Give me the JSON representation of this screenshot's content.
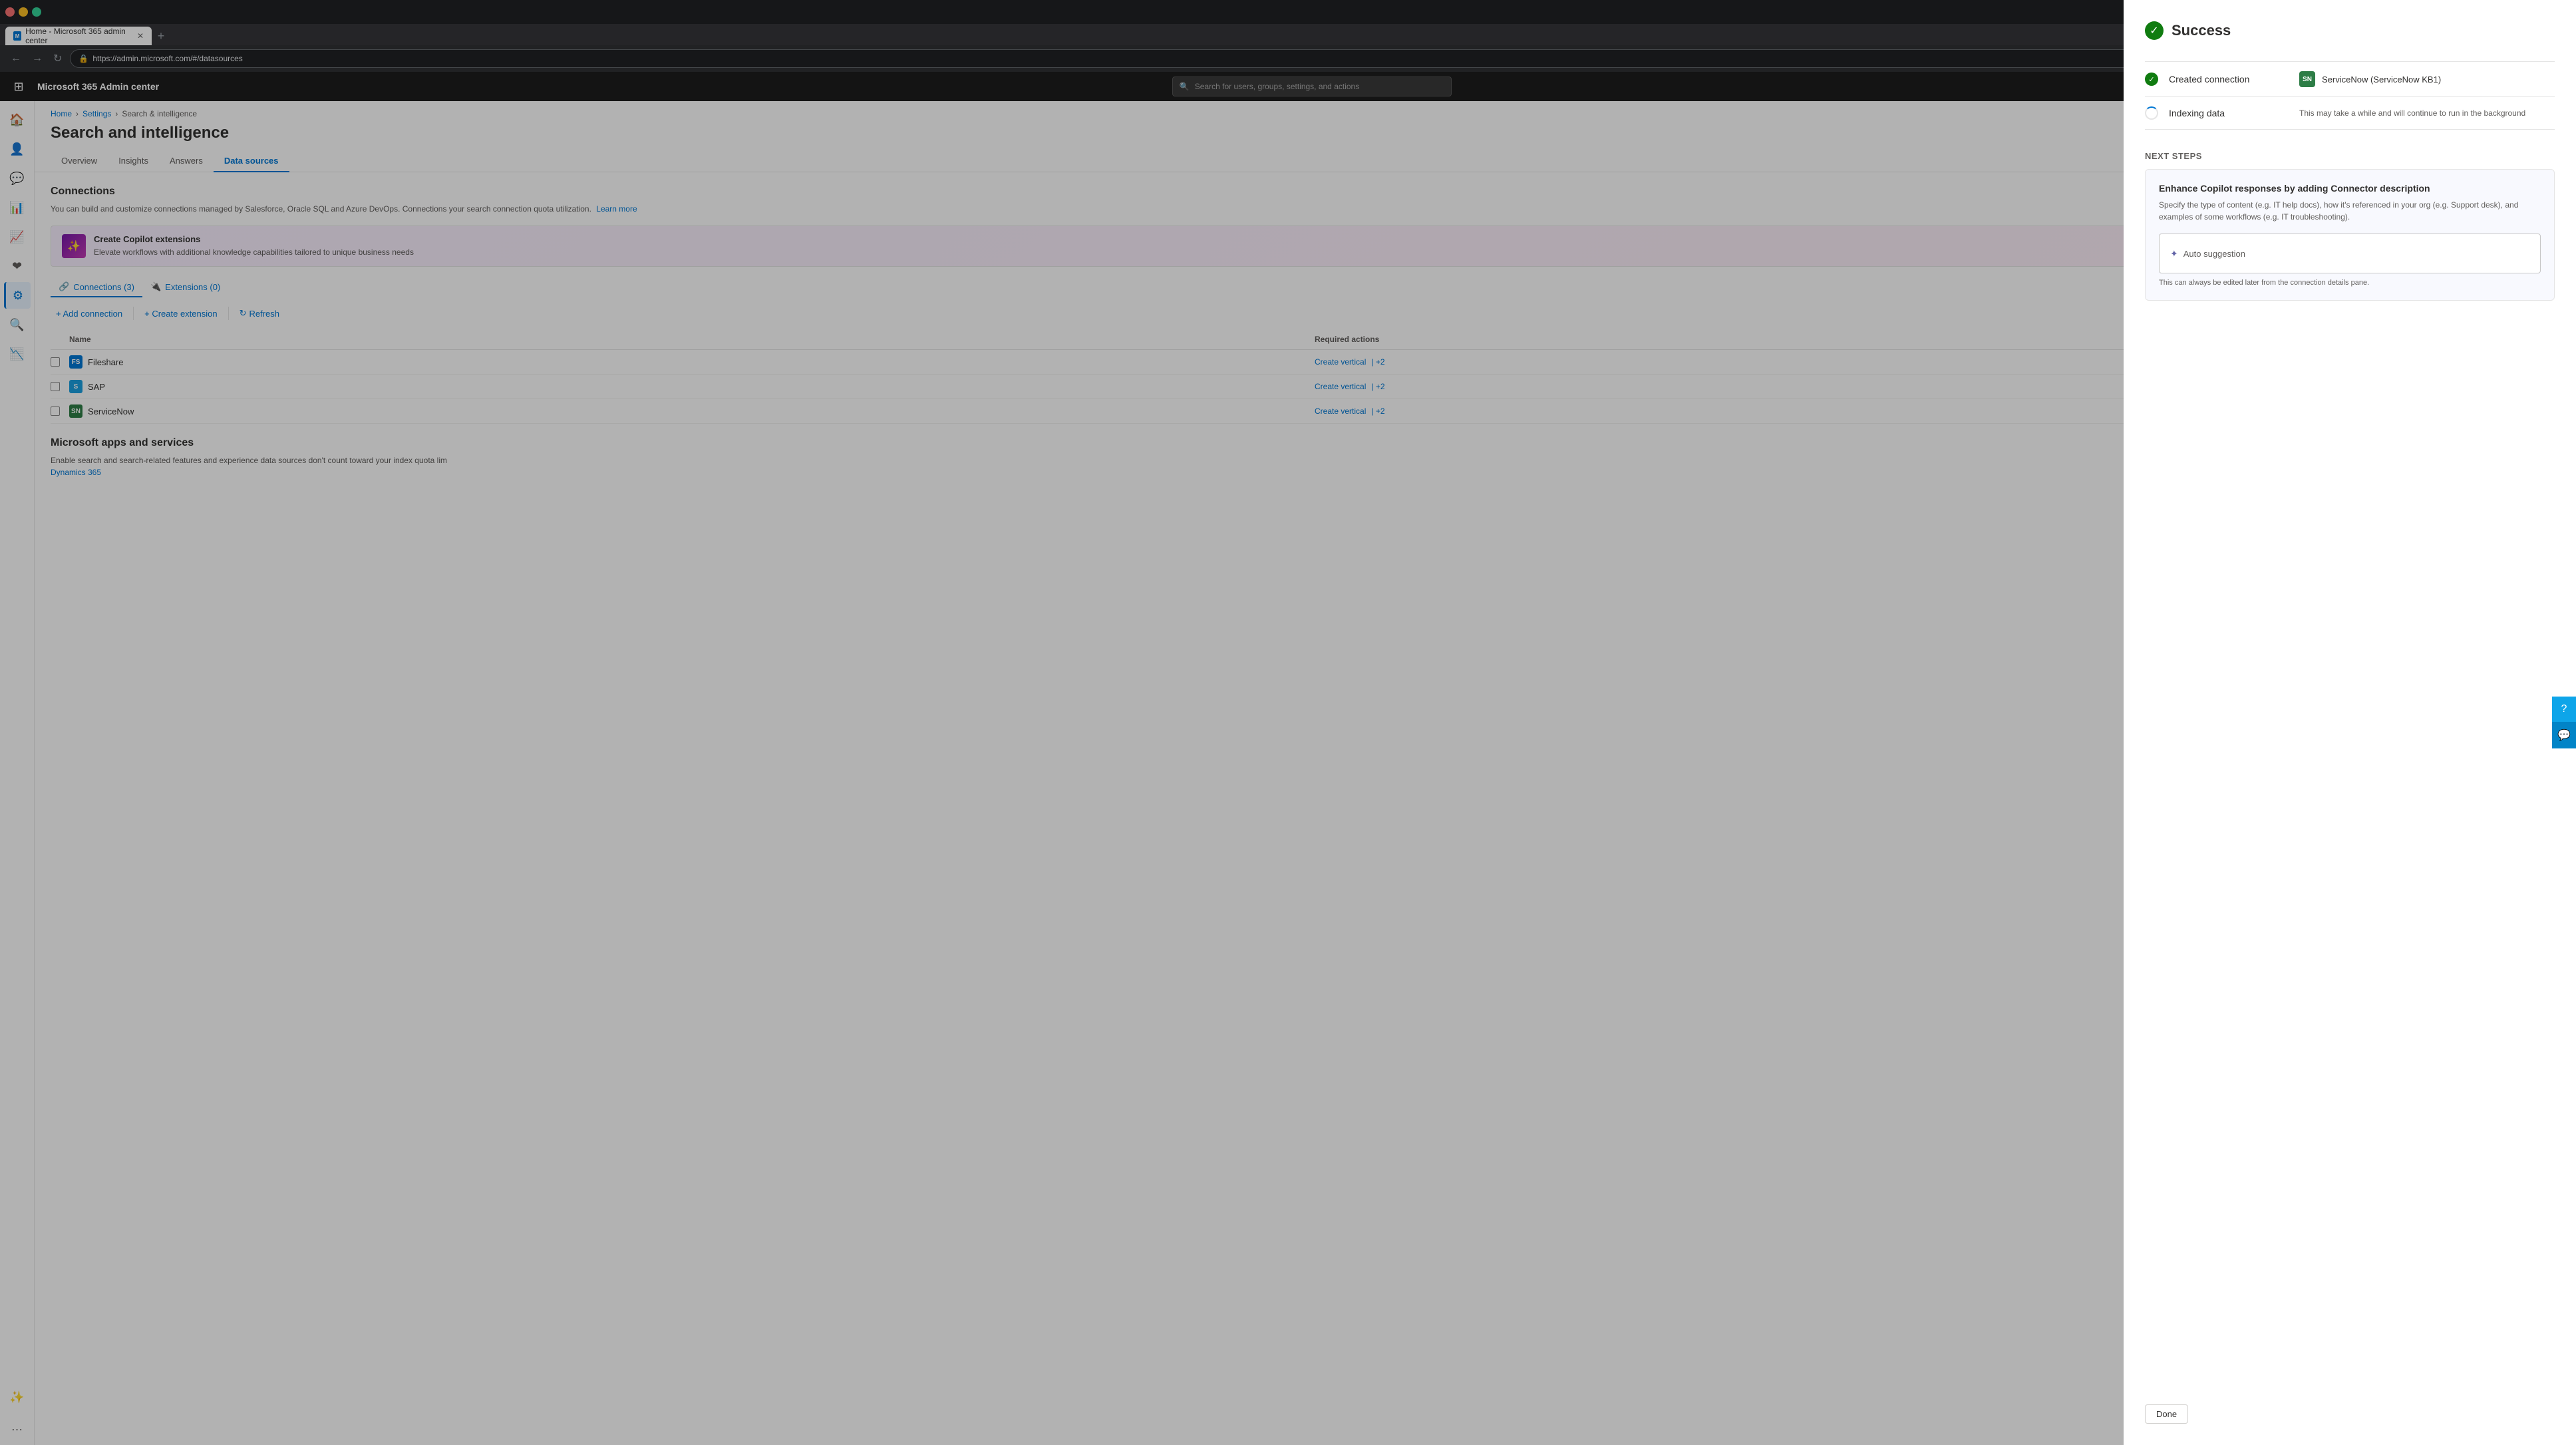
{
  "browser": {
    "tab_title": "Home - Microsoft 365 admin center",
    "address": "https://admin.microsoft.com/#/datasources",
    "new_tab_label": "+"
  },
  "top_nav": {
    "title": "Microsoft 365 Admin center",
    "search_placeholder": "Search for users, groups, settings, and actions"
  },
  "breadcrumb": {
    "home": "Home",
    "settings": "Settings",
    "current": "Search & intelligence"
  },
  "page": {
    "title": "Search and intelligence",
    "tabs": [
      {
        "label": "Overview",
        "active": false
      },
      {
        "label": "Insights",
        "active": false
      },
      {
        "label": "Answers",
        "active": false
      },
      {
        "label": "Data sources",
        "active": true
      }
    ]
  },
  "connections": {
    "section_title": "Connections",
    "description": "You can build and customize connections managed by Salesforce, Oracle SQL and Azure DevOps. Connections your search connection quota utilization.",
    "learn_more": "Learn more",
    "extensions_banner": {
      "title": "Create Copilot extensions",
      "description": "Elevate workflows with additional knowledge capabilities tailored to unique business needs"
    },
    "sub_tabs": [
      {
        "label": "Connections (3)",
        "active": true
      },
      {
        "label": "Extensions (0)",
        "active": false
      }
    ],
    "toolbar": {
      "add_connection": "+ Add connection",
      "create_extension": "+ Create extension",
      "refresh": "Refresh"
    },
    "table": {
      "headers": [
        "",
        "Name",
        "Required actions"
      ],
      "rows": [
        {
          "name": "Fileshare",
          "icon_type": "fileshare",
          "icon_label": "FS",
          "actions": "Create vertical",
          "actions_extra": "| +2"
        },
        {
          "name": "SAP",
          "icon_type": "sap",
          "icon_label": "S",
          "actions": "Create vertical",
          "actions_extra": "| +2"
        },
        {
          "name": "ServiceNow",
          "icon_type": "servicenow",
          "icon_label": "SN",
          "actions": "Create vertical",
          "actions_extra": "| +2"
        }
      ]
    }
  },
  "ms_apps": {
    "title": "Microsoft apps and services",
    "description": "Enable search and search-related features and experience data sources don't count toward your index quota lim",
    "dynamics_link": "Dynamics 365"
  },
  "panel": {
    "success_title": "Success",
    "steps": [
      {
        "status": "done",
        "name": "Created connection",
        "detail_icon": "SN",
        "detail_text": "ServiceNow (ServiceNow KB1)"
      },
      {
        "status": "loading",
        "name": "Indexing data",
        "detail_text": "This may take a while and will continue to run in the background"
      }
    ],
    "next_steps_label": "Next steps",
    "enhance_card": {
      "title": "Enhance Copilot responses by adding Connector description",
      "description": "Specify the type of content (e.g. IT help docs), how it's referenced in your org (e.g. Support desk), and examples of some workflows (e.g. IT troubleshooting).",
      "suggestion_label": "Auto suggestion",
      "edit_note": "This can always be edited later from the connection details pane."
    },
    "done_button": "Done"
  },
  "help": {
    "btn1": "?",
    "btn2": "💬"
  }
}
